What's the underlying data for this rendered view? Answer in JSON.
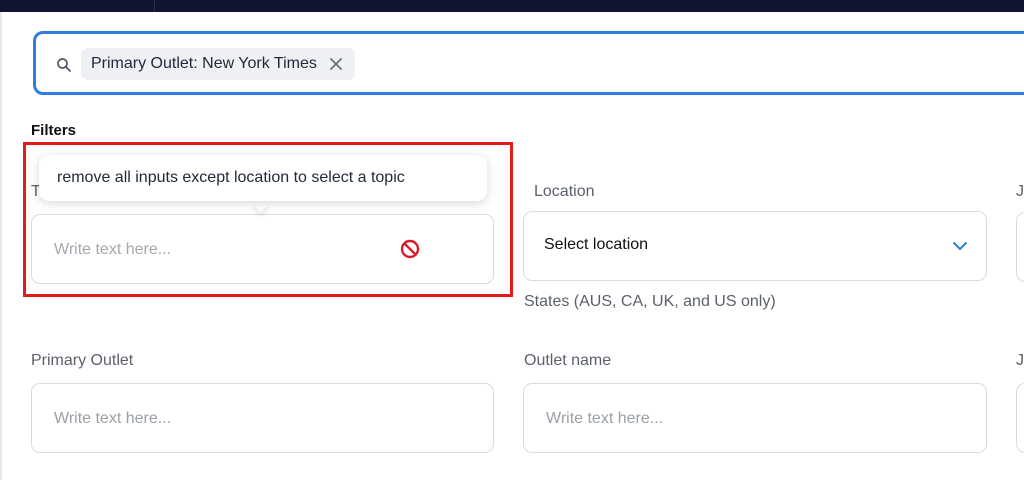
{
  "search": {
    "chip_label": "Primary Outlet: New York Times",
    "icon": "search-icon",
    "remove_icon": "close-icon"
  },
  "filters": {
    "title": "Filters",
    "topic": {
      "label": "T",
      "placeholder": "Write text here...",
      "status_icon": "blocked-icon",
      "tooltip": "remove all inputs except location to select a topic"
    },
    "location": {
      "label": "Location",
      "value": "Select location",
      "hint": "States (AUS, CA, UK, and US only)"
    },
    "third_column_label_1": "J",
    "primary_outlet": {
      "label": "Primary Outlet",
      "placeholder": "Write text here..."
    },
    "outlet_name": {
      "label": "Outlet name",
      "placeholder": "Write text here..."
    },
    "third_column_label_2": "J"
  },
  "colors": {
    "accent": "#2f7de1",
    "highlight": "#e01b1b",
    "topbar": "#0f1431",
    "blocked": "#d61f2c"
  }
}
